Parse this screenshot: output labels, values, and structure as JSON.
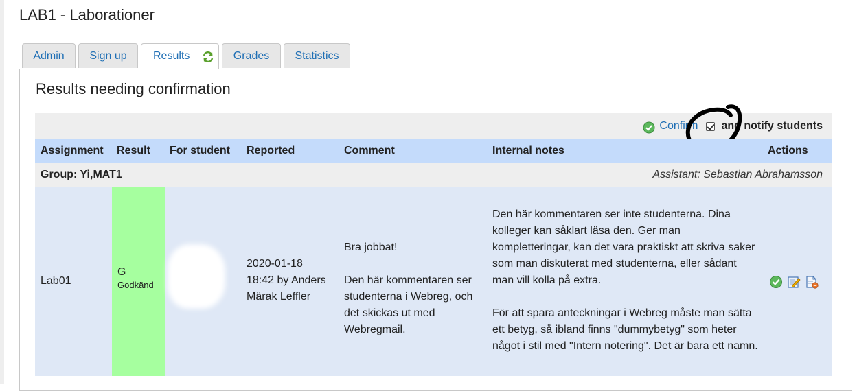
{
  "page": {
    "title": "LAB1 - Laborationer"
  },
  "tabs": [
    {
      "label": "Admin"
    },
    {
      "label": "Sign up"
    },
    {
      "label": "Results"
    },
    {
      "label": "Grades"
    },
    {
      "label": "Statistics"
    }
  ],
  "active_tab": "Results",
  "section": {
    "title": "Results needing confirmation"
  },
  "actionbar": {
    "confirm_label": "Confirm",
    "notify_label": "and notify students",
    "notify_checked": true
  },
  "table": {
    "headers": {
      "assignment": "Assignment",
      "result": "Result",
      "for_student": "For student",
      "reported": "Reported",
      "comment": "Comment",
      "internal_notes": "Internal notes",
      "actions": "Actions"
    },
    "group": {
      "label": "Group: Yi,MAT1",
      "assistant": "Assistant: Sebastian Abrahamsson"
    },
    "rows": [
      {
        "assignment": "Lab01",
        "result_code": "G",
        "result_text": "Godkänd",
        "reported_line1": "2020-01-18",
        "reported_line2": "18:42 by Anders Märak Leffler",
        "comment_p1": "Bra jobbat!",
        "comment_p2": "Den här kommentaren ser studenterna i Webreg, och det skickas ut med Webregmail.",
        "notes_p1": "Den här kommentaren ser inte studenterna. Dina kolleger kan såklart läsa den. Ger man kompletteringar, kan det vara praktiskt att skriva saker som man diskuterat med studenterna, eller sådant man vill kolla på extra.",
        "notes_p2": "För att spara anteckningar i Webreg måste man sätta ett betyg, så ibland finns \"dummybetyg\" som heter något i stil med \"Intern notering\". Det är bara ett namn."
      }
    ]
  },
  "colors": {
    "link": "#1f6fb5",
    "header_bg": "#c4dbfb",
    "row_bg": "#dfe8f6",
    "result_bg": "#a6ff9f",
    "bar_bg": "#eeeeee",
    "confirm_green": "#5cb85c"
  },
  "icons": {
    "tab_refresh": "refresh-icon",
    "confirm": "check-circle-icon",
    "row_actions": [
      "check-circle-icon",
      "edit-icon",
      "delete-document-icon"
    ]
  }
}
